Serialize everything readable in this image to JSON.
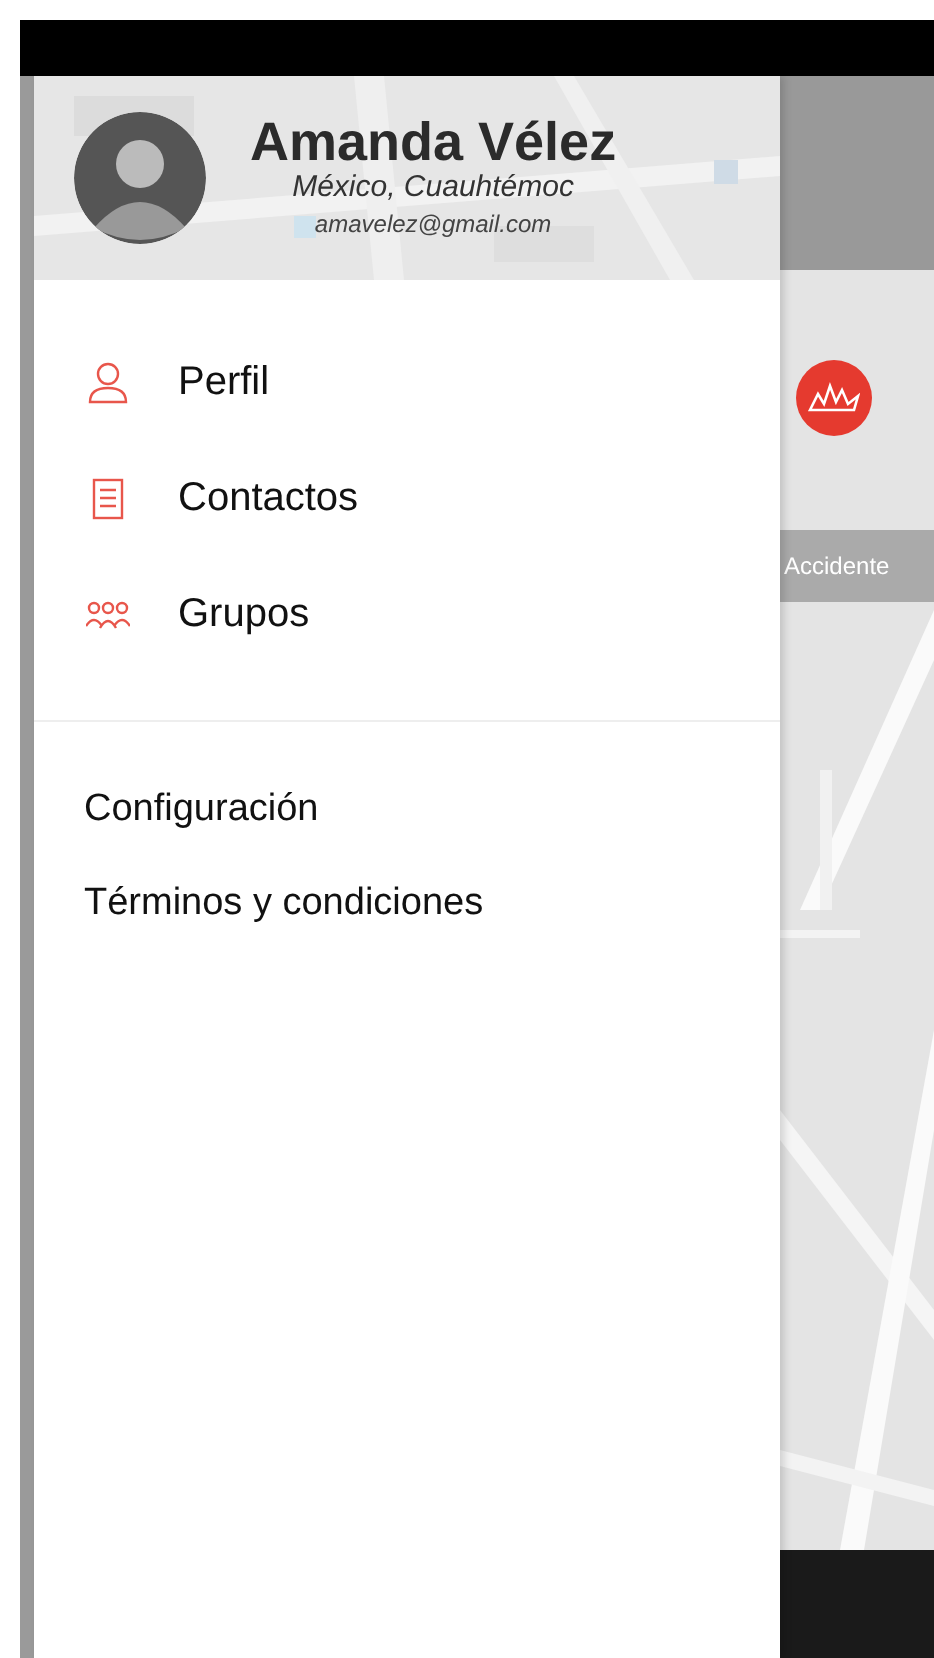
{
  "profile": {
    "name": "Amanda Vélez",
    "location": "México, Cuauhtémoc",
    "email": "amavelez@gmail.com"
  },
  "menu": [
    {
      "label": "Perfil",
      "kind": "person"
    },
    {
      "label": "Contactos",
      "kind": "document"
    },
    {
      "label": "Grupos",
      "kind": "group"
    }
  ],
  "links": [
    "Configuración",
    "Términos y condiciones"
  ],
  "map_behind": {
    "alert_label": "Accidente"
  }
}
